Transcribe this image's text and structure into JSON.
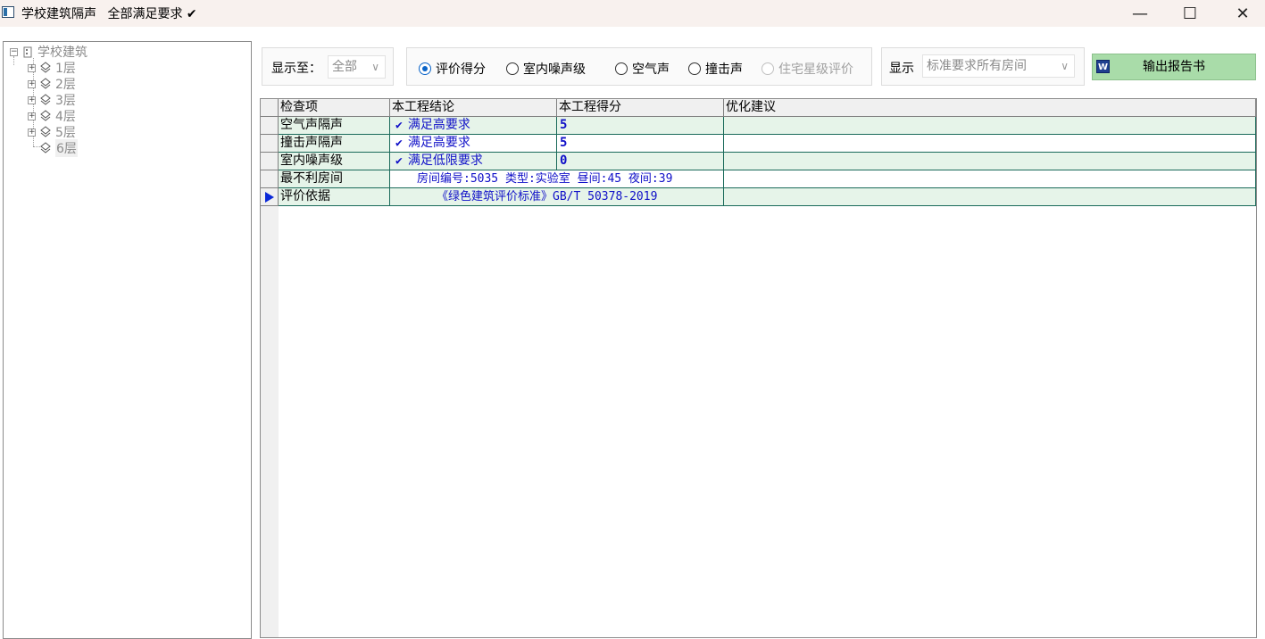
{
  "window": {
    "title": "学校建筑隔声",
    "status": "全部满足要求",
    "status_mark": "✔",
    "minimize": "—",
    "maximize": "☐",
    "close": "✕"
  },
  "tree": {
    "root": "学校建筑",
    "floors": [
      "1层",
      "2层",
      "3层",
      "4层",
      "5层",
      "6层"
    ]
  },
  "toolbar": {
    "display_to_label": "显示至：",
    "display_to_value": "全部",
    "radios": {
      "score": "评价得分",
      "indoor_noise": "室内噪声级",
      "airborne": "空气声",
      "impact": "撞击声",
      "residential_star": "住宅星级评价"
    },
    "selected_radio": "评价得分",
    "show_label": "显示",
    "show_value": "标准要求所有房间",
    "report_button": "输出报告书",
    "word_icon_letter": "W"
  },
  "grid": {
    "headers": [
      "检查项",
      "本工程结论",
      "本工程得分",
      "优化建议"
    ],
    "rows": [
      {
        "item": "空气声隔声",
        "conclusion": "满足高要求",
        "score": "5",
        "advice": ""
      },
      {
        "item": "撞击声隔声",
        "conclusion": "满足高要求",
        "score": "5",
        "advice": ""
      },
      {
        "item": "室内噪声级",
        "conclusion": "满足低限要求",
        "score": "0",
        "advice": ""
      },
      {
        "item": "最不利房间",
        "info": "房间编号:5035 类型:实验室 昼间:45 夜间:39"
      },
      {
        "item": "评价依据",
        "info": "《绿色建筑评价标准》GB/T 50378-2019"
      }
    ],
    "check_mark": "✔"
  },
  "colors": {
    "titlebar_bg": "#f8f1ee",
    "row_green": "#e6f4e9",
    "grid_line": "#1a6a5a",
    "accent_blue": "#1010c8",
    "report_button_bg": "#a9dca9"
  }
}
